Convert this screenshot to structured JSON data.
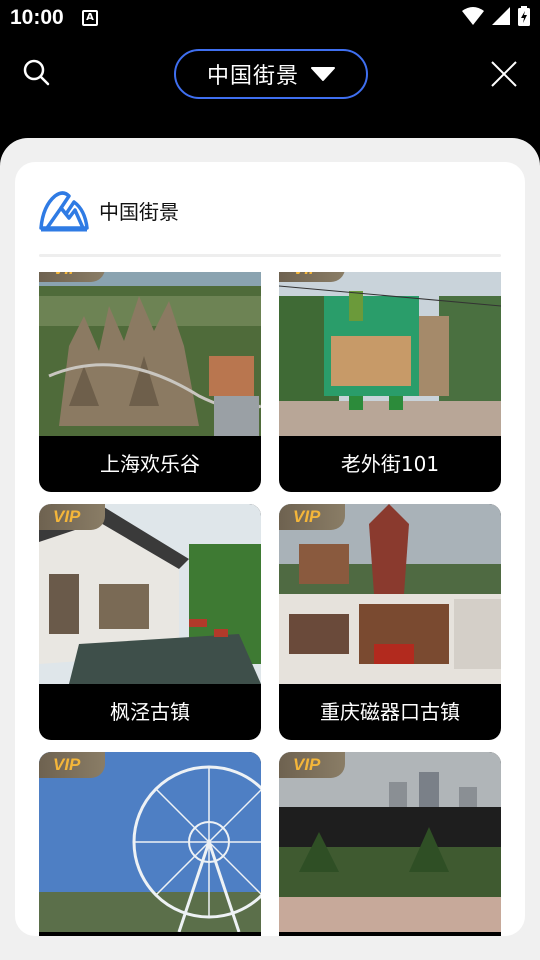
{
  "status_bar": {
    "time": "10:00",
    "notification_letter": "A"
  },
  "header": {
    "title": "中国街景"
  },
  "card": {
    "title": "中国街景"
  },
  "vip_badge": "VIP",
  "tiles": [
    {
      "label": "上海欢乐谷",
      "vip": true
    },
    {
      "label": "老外街101",
      "vip": true
    },
    {
      "label": "枫泾古镇",
      "vip": true
    },
    {
      "label": "重庆磁器口古镇",
      "vip": true
    },
    {
      "label": "",
      "vip": true
    },
    {
      "label": "",
      "vip": true
    }
  ],
  "colors": {
    "accent_blue": "#3f6ff0",
    "vip_text": "#f4b63a",
    "logo_blue": "#2f7be4"
  }
}
